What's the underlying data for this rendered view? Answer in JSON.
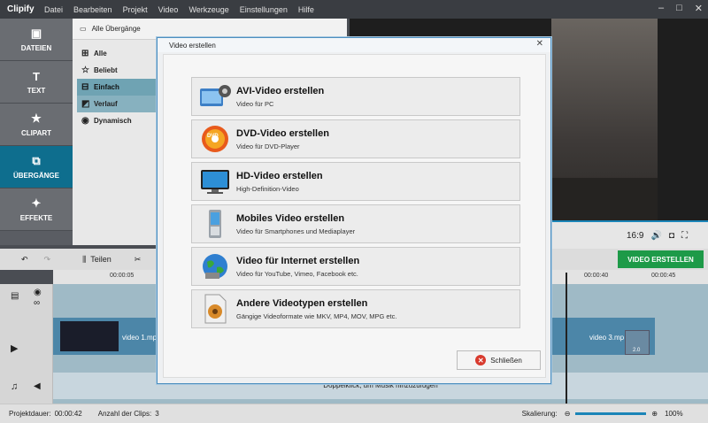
{
  "app": {
    "logo": "Clipify",
    "menu": [
      "Datei",
      "Bearbeiten",
      "Projekt",
      "Video",
      "Werkzeuge",
      "Einstellungen",
      "Hilfe"
    ]
  },
  "nav": [
    {
      "label": "DATEIEN",
      "icon": "image-icon"
    },
    {
      "label": "TEXT",
      "icon": "text-icon"
    },
    {
      "label": "CLIPART",
      "icon": "star-icon"
    },
    {
      "label": "ÜBERGÄNGE",
      "icon": "transition-icon"
    },
    {
      "label": "EFFEKTE",
      "icon": "magic-wand-icon"
    }
  ],
  "transitions": {
    "header": "Alle Übergänge",
    "categories": [
      "Alle",
      "Beliebt",
      "Einfach",
      "Verlauf",
      "Dynamisch"
    ]
  },
  "preview": {
    "aspect": "16:9"
  },
  "export_button": "VIDEO ERSTELLEN",
  "timeline": {
    "split_label": "Teilen",
    "ruler": [
      "00:00:05",
      "00:00:40",
      "00:00:45"
    ],
    "clips": [
      "video 1.mp",
      "video 3.mp"
    ],
    "clip_badge": "2.0",
    "music_hint": "Doppelklick, um Musik hinzuzufügen"
  },
  "status": {
    "duration_label": "Projektdauer:",
    "duration_value": "00:00:42",
    "clips_label": "Anzahl der Clips:",
    "clips_value": "3",
    "scale_label": "Skalierung:",
    "zoom": "100%"
  },
  "dialog": {
    "title": "Video erstellen",
    "options": [
      {
        "title": "AVI-Video erstellen",
        "subtitle": "Video für PC",
        "icon": "avi-film-icon"
      },
      {
        "title": "DVD-Video erstellen",
        "subtitle": "Video für DVD-Player",
        "icon": "dvd-disc-icon"
      },
      {
        "title": "HD-Video erstellen",
        "subtitle": "High-Definition-Video",
        "icon": "hd-monitor-icon"
      },
      {
        "title": "Mobiles Video erstellen",
        "subtitle": "Video für Smartphones und Mediaplayer",
        "icon": "mobile-phone-icon"
      },
      {
        "title": "Video für Internet erstellen",
        "subtitle": "Video für YouTube, Vimeo, Facebook etc.",
        "icon": "globe-icon"
      },
      {
        "title": "Andere Videotypen erstellen",
        "subtitle": "Gängige Videoformate wie MKV, MP4, MOV, MPG etc.",
        "icon": "video-file-icon"
      }
    ],
    "close_label": "Schließen"
  }
}
